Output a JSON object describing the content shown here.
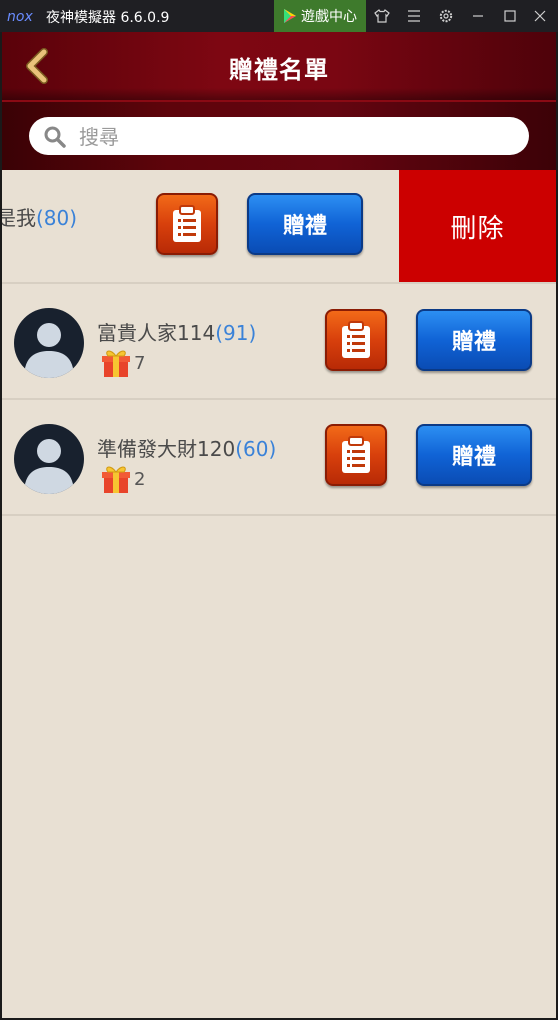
{
  "window": {
    "title": "夜神模擬器 6.6.0.9",
    "game_center_label": "遊戲中心",
    "game_center_color": "#3e7a2c",
    "toolbar_icons": [
      "shirt-icon",
      "menu-icon",
      "settings-icon",
      "minimize-icon",
      "maximize-icon",
      "close-icon"
    ]
  },
  "header": {
    "title": "贈禮名單",
    "back_icon": "chevron-left-icon",
    "accent_color": "#7e0712"
  },
  "search": {
    "placeholder": "搜尋",
    "value": ""
  },
  "friends": [
    {
      "name_fragment": "是我",
      "level": "(80)",
      "gift_label": "贈禮",
      "delete_label": "刪除",
      "swiped": true
    },
    {
      "name": "富貴人家114",
      "level": "(91)",
      "gift_count": "7",
      "gift_label": "贈禮"
    },
    {
      "name": "準備發大財120",
      "level": "(60)",
      "gift_count": "2",
      "gift_label": "贈禮"
    }
  ],
  "colors": {
    "level_text": "#3a82d8",
    "delete_bg": "#cc0000",
    "gift_button": "#1063d6",
    "note_button": "#d8400c"
  }
}
